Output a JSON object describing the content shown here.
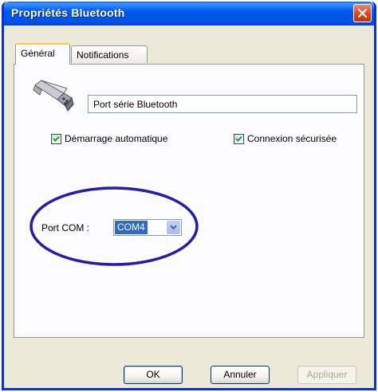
{
  "window": {
    "title": "Propriétés Bluetooth"
  },
  "tabs": [
    {
      "label": "Général",
      "active": true
    },
    {
      "label": "Notifications",
      "active": false
    }
  ],
  "device": {
    "icon": "serial-port-connector-icon",
    "name_value": "Port série Bluetooth"
  },
  "options": {
    "auto_start": {
      "label": "Démarrage automatique",
      "checked": true
    },
    "secure_connection": {
      "label": "Connexion sécurisée",
      "checked": true
    }
  },
  "com_port": {
    "label": "Port COM :",
    "selected": "COM4"
  },
  "buttons": {
    "ok": "OK",
    "cancel": "Annuler",
    "apply": "Appliquer"
  },
  "colors": {
    "titlebar": "#0058ee",
    "highlight_ellipse": "#1f1fa8",
    "selection": "#316ac5"
  }
}
